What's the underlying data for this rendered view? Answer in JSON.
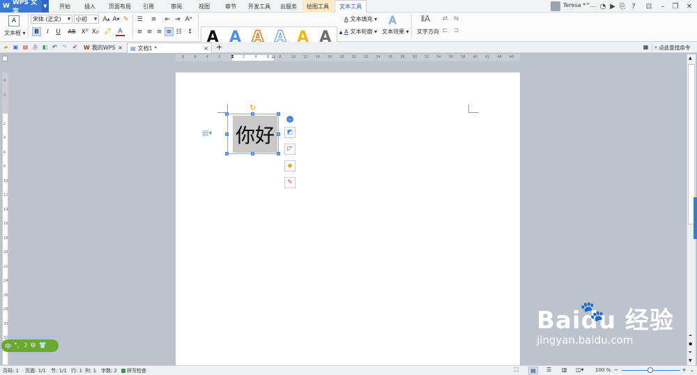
{
  "app": {
    "brand": "WPS 文字"
  },
  "tabs": [
    "开始",
    "插入",
    "页面布局",
    "引用",
    "审阅",
    "视图",
    "章节",
    "开发工具",
    "云服务",
    "绘图工具",
    "文本工具"
  ],
  "active_tab": "文本工具",
  "user": {
    "name": "Teresa *^..."
  },
  "ribbon": {
    "textbox_label": "文本框",
    "font_name": "宋体 (正文)",
    "font_size": "小初",
    "bold": "B",
    "italic": "I",
    "underline": "U",
    "strike": "AB",
    "superscript": "X²",
    "subscript": "X₂",
    "text_fill": "文本填充",
    "text_outline": "文本轮廓",
    "text_effect": "文本效果",
    "text_direction": "文字方向",
    "style_letters": [
      "A",
      "A",
      "A",
      "A",
      "A",
      "A"
    ]
  },
  "quick": {
    "doc_tabs": [
      "我的WPS",
      "文档1 *"
    ],
    "search": "点此查找命令"
  },
  "ruler_h": [
    "8",
    "6",
    "4",
    "2",
    "",
    "2",
    "4",
    "6",
    "8",
    "10",
    "12",
    "14",
    "16",
    "18",
    "20",
    "22",
    "24",
    "26",
    "28",
    "30",
    "32",
    "34",
    "36",
    "38",
    "40",
    "42",
    "44",
    "46"
  ],
  "ruler_v": [
    "4",
    "2",
    "",
    "2",
    "4",
    "6",
    "8",
    "10",
    "12",
    "14",
    "16",
    "18",
    "20",
    "22",
    "24",
    "26",
    "28",
    "30",
    "32"
  ],
  "document": {
    "textbox_text": "你好"
  },
  "statusbar": {
    "page": "页码: 1",
    "pages": "页面: 1/1",
    "section": "节: 1/1",
    "line": "行: 1",
    "col": "列: 1",
    "chars": "字数: 2",
    "spell": "拼写检查",
    "zoom": "100 %"
  },
  "ime": {
    "label": "中"
  },
  "watermark": {
    "brand": "Baidu 经验",
    "url": "jingyan.baidu.com"
  },
  "colors": {
    "accent": "#3b7ad1",
    "ime": "#6aa92f",
    "page_bg": "#bcc3cc"
  }
}
